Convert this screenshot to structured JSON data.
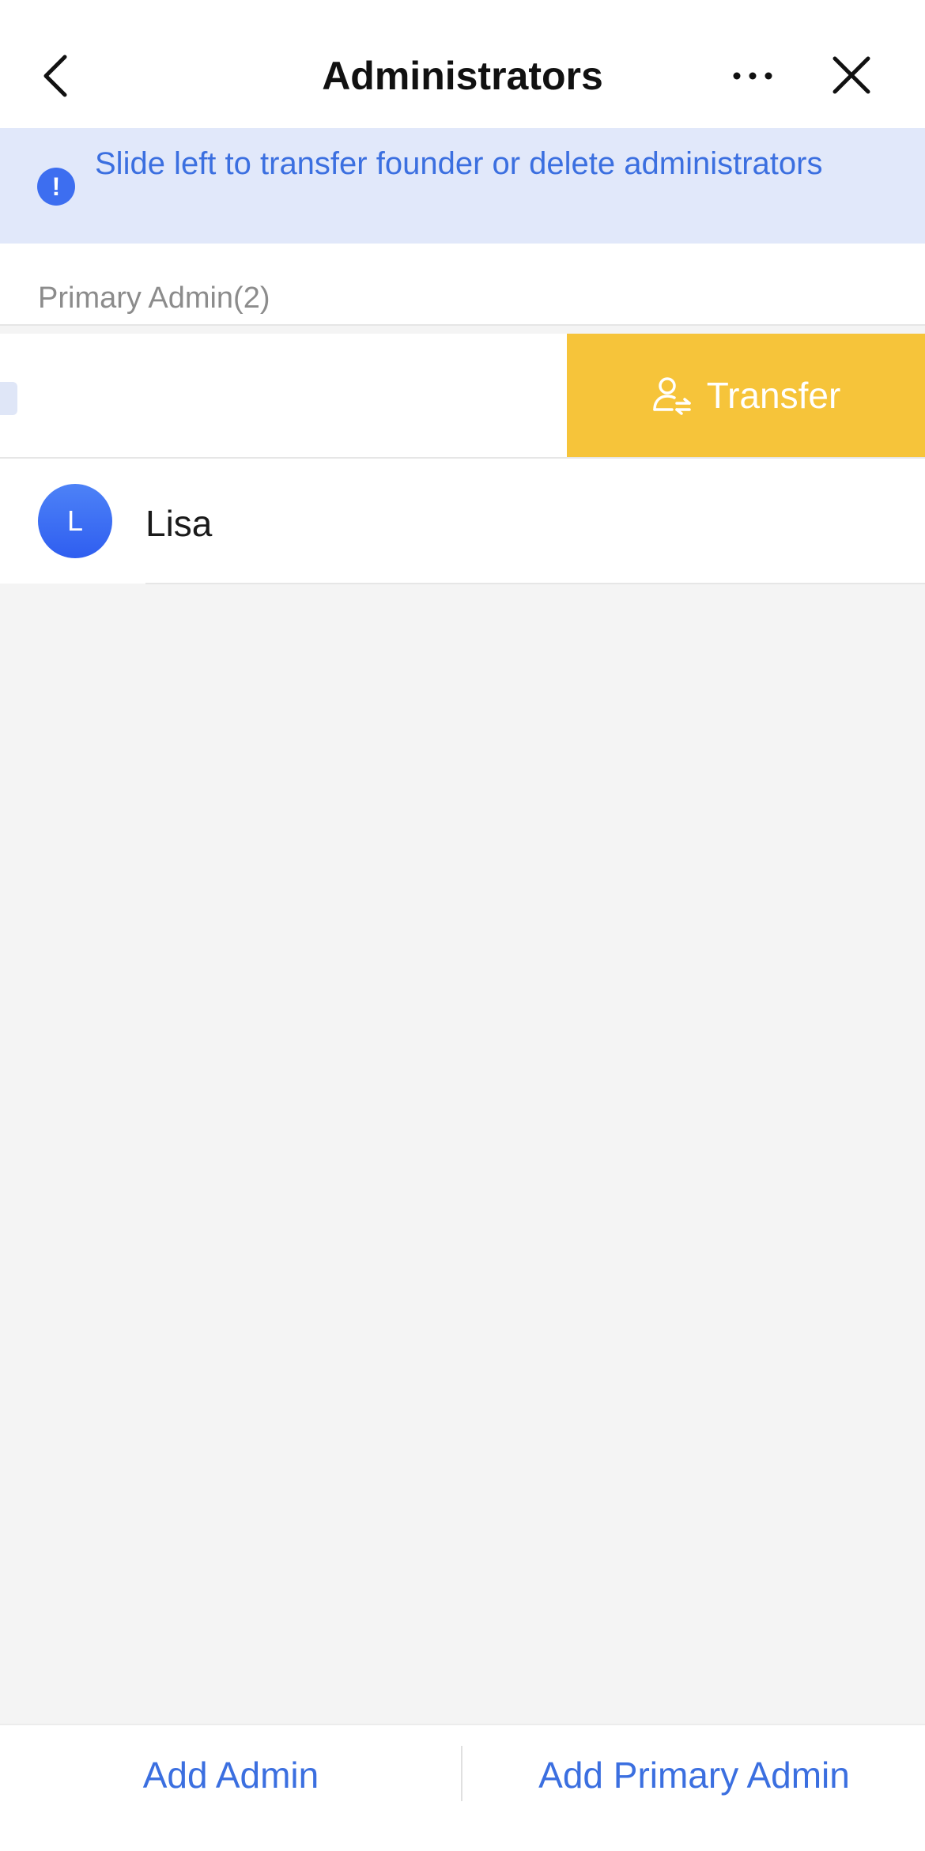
{
  "header": {
    "title": "Administrators",
    "back_icon": "chevron-left-icon",
    "more_icon": "more-horizontal-icon",
    "close_icon": "close-icon"
  },
  "notice": {
    "icon": "exclamation-info-icon",
    "icon_glyph": "!",
    "text": "Slide left to transfer founder or delete administrators"
  },
  "section": {
    "label": "Primary Admin(2)"
  },
  "swiped_row": {
    "action_label": "Transfer",
    "action_icon": "user-transfer-icon",
    "action_color": "#f6c43a"
  },
  "admins": [
    {
      "initial": "L",
      "name": "Lisa"
    }
  ],
  "bottom_bar": {
    "add_admin": "Add Admin",
    "add_primary_admin": "Add Primary Admin"
  },
  "colors": {
    "accent": "#3b6fe0",
    "notice_bg": "#e1e8fa",
    "avatar": "#3d6ef0"
  }
}
